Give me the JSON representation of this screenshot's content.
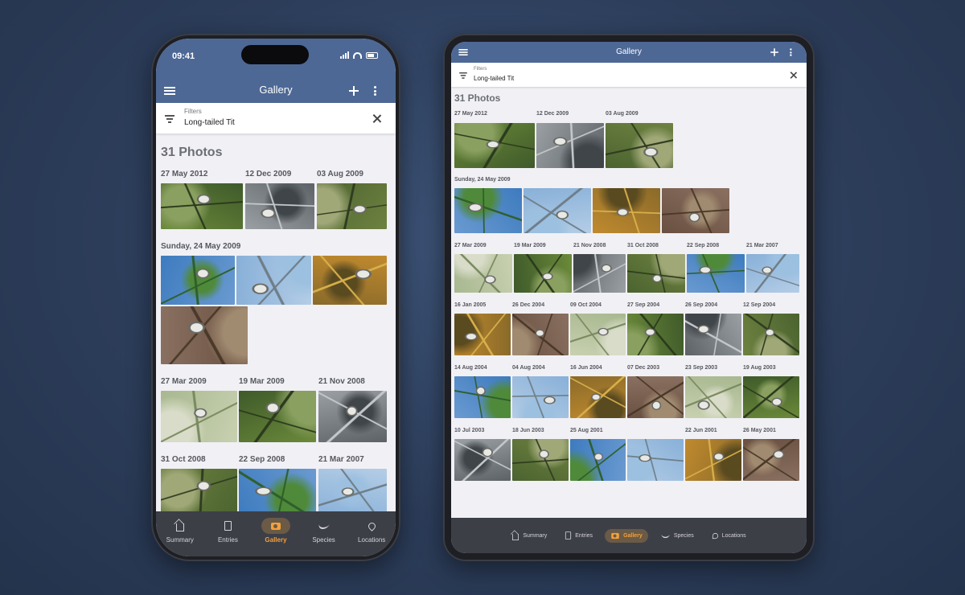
{
  "app": {
    "title": "Gallery",
    "status_time": "09:41",
    "filter_label": "Filters",
    "filter_value": "Long-tailed Tit",
    "photo_count": "31 Photos"
  },
  "nav": [
    {
      "label": "Summary",
      "icon": "home-icon",
      "active": false
    },
    {
      "label": "Entries",
      "icon": "document-icon",
      "active": false
    },
    {
      "label": "Gallery",
      "icon": "camera-icon",
      "active": true
    },
    {
      "label": "Species",
      "icon": "bird-icon",
      "active": false
    },
    {
      "label": "Locations",
      "icon": "location-pin-icon",
      "active": false
    }
  ],
  "colors": {
    "appbar": "#4d6895",
    "nav_bg": "#3d3f47",
    "accent": "#f3a13c",
    "screen_bg": "#f1f0f5"
  },
  "phone_dates": [
    "27 May 2012",
    "12 Dec 2009",
    "03 Aug 2009",
    "Sunday, 24 May 2009",
    "27 Mar 2009",
    "19 Mar 2009",
    "21 Nov 2008",
    "31 Oct 2008",
    "22 Sep 2008",
    "21 Mar 2007"
  ],
  "tablet_dates": [
    "27 May 2012",
    "12 Dec 2009",
    "03 Aug 2009",
    "Sunday, 24 May 2009",
    "27 Mar 2009",
    "19 Mar 2009",
    "21 Nov 2008",
    "31 Oct 2008",
    "22 Sep 2008",
    "21 Mar 2007",
    "16 Jan 2005",
    "26 Dec 2004",
    "09 Oct 2004",
    "27 Sep 2004",
    "26 Sep 2004",
    "12 Sep 2004",
    "14 Aug 2004",
    "04 Aug 2004",
    "16 Jun 2004",
    "07 Dec 2003",
    "23 Sep 2003",
    "19 Aug 2003",
    "10 Jul 2003",
    "18 Jun 2003",
    "25 Aug 2001",
    "22 Jun 2001",
    "26 May 2001"
  ]
}
